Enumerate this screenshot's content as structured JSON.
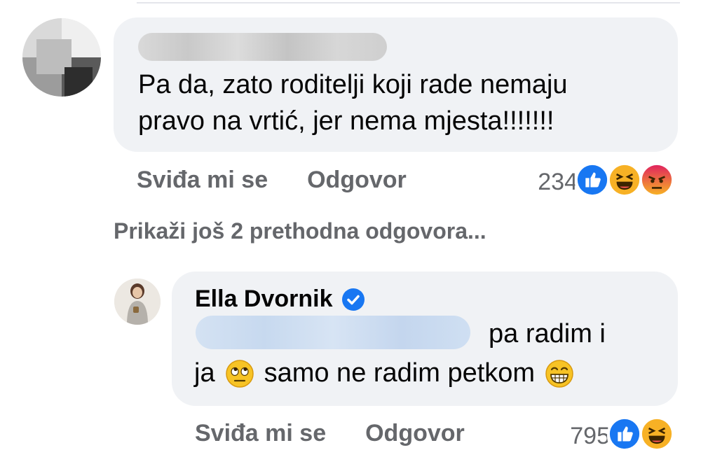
{
  "comment1": {
    "text_line1": "Pa da, zato roditelji koji rade nemaju",
    "text_line2": "pravo na vrtić, jer nema mjesta!!!!!!!",
    "actions": {
      "like": "Sviđa mi se",
      "reply": "Odgovor"
    },
    "reaction_count": "234",
    "reactions": [
      "like-icon",
      "haha-icon",
      "angry-icon"
    ]
  },
  "more_replies": "Prikaži još 2 prethodna odgovora...",
  "reply": {
    "author": "Ella Dvornik",
    "text_line1_tail": "pa radim i",
    "text_line2_a": "ja",
    "text_line2_b": "samo ne radim petkom",
    "emojis": [
      "eye-roll-emoji",
      "grin-emoji"
    ],
    "actions": {
      "like": "Sviđa mi se",
      "reply": "Odgovor"
    },
    "reaction_count": "795",
    "reactions": [
      "like-icon",
      "haha-icon"
    ]
  },
  "colors": {
    "bubble": "#f0f2f5",
    "action_text": "#65676b",
    "like_blue": "#1877f2",
    "haha_yellow": "#f7b125",
    "angry_red": "#e9710f"
  }
}
